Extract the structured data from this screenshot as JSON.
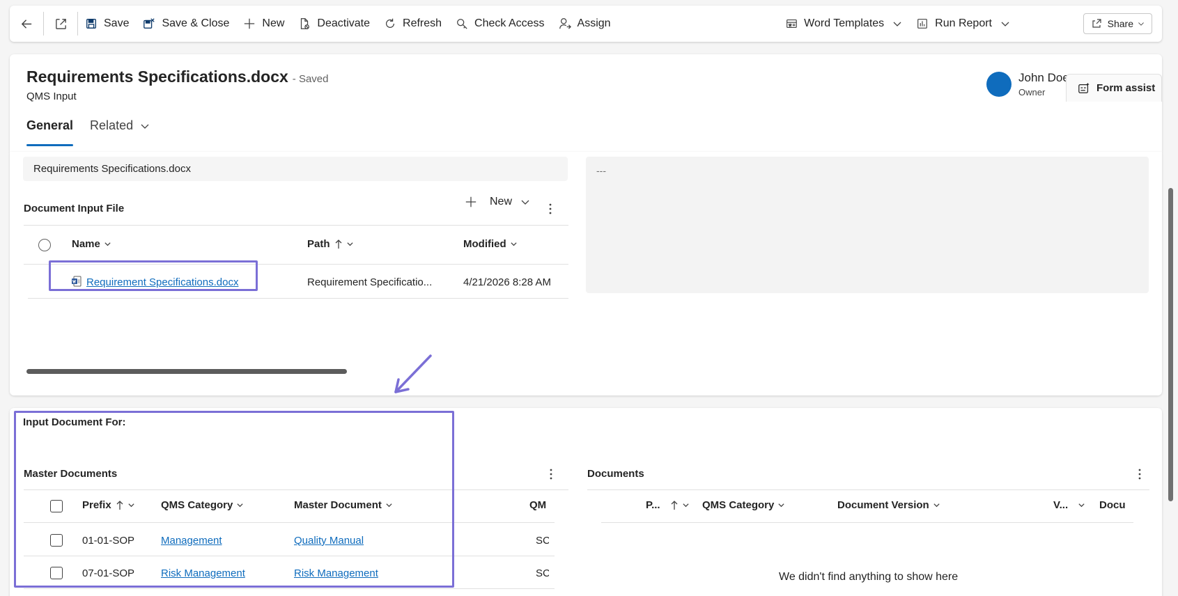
{
  "command_bar": {
    "save": "Save",
    "save_close": "Save & Close",
    "new": "New",
    "deactivate": "Deactivate",
    "refresh": "Refresh",
    "check_access": "Check Access",
    "assign": "Assign",
    "word_templates": "Word Templates",
    "run_report": "Run Report",
    "share": "Share"
  },
  "header": {
    "title": "Requirements Specifications.docx",
    "status": "- Saved",
    "entity": "QMS Input",
    "owner_name": "John Doe",
    "owner_role": "Owner",
    "tabs": [
      {
        "label": "General"
      },
      {
        "label": "Related"
      }
    ],
    "form_assist": "Form assist"
  },
  "general": {
    "name_value": "Requirements Specifications.docx",
    "right_value": "---"
  },
  "document_input_file": {
    "title": "Document Input File",
    "new_label": "New",
    "columns": [
      "Name",
      "Path",
      "Modified"
    ],
    "rows": [
      {
        "name": "Requirement Specifications.docx",
        "path": "Requirement Specificatio...",
        "modified": "4/21/2026 8:28 AM"
      }
    ]
  },
  "input_document_for": {
    "title": "Input Document For:",
    "master_documents": {
      "title": "Master Documents",
      "columns": [
        "Prefix",
        "QMS Category",
        "Master Document",
        "QM"
      ],
      "rows": [
        {
          "prefix": "01-01-SOP",
          "category": "Management",
          "master": "Quality Manual",
          "qm": "SC"
        },
        {
          "prefix": "07-01-SOP",
          "category": "Risk Management",
          "master": "Risk Management",
          "qm": "SC"
        }
      ]
    },
    "documents": {
      "title": "Documents",
      "columns": [
        "P...",
        "QMS Category",
        "Document Version",
        "V...",
        "Docu"
      ],
      "empty": "We didn't find anything to show here"
    }
  },
  "colors": {
    "accent": "#0f6cbd",
    "highlight": "#7b6fd6"
  }
}
